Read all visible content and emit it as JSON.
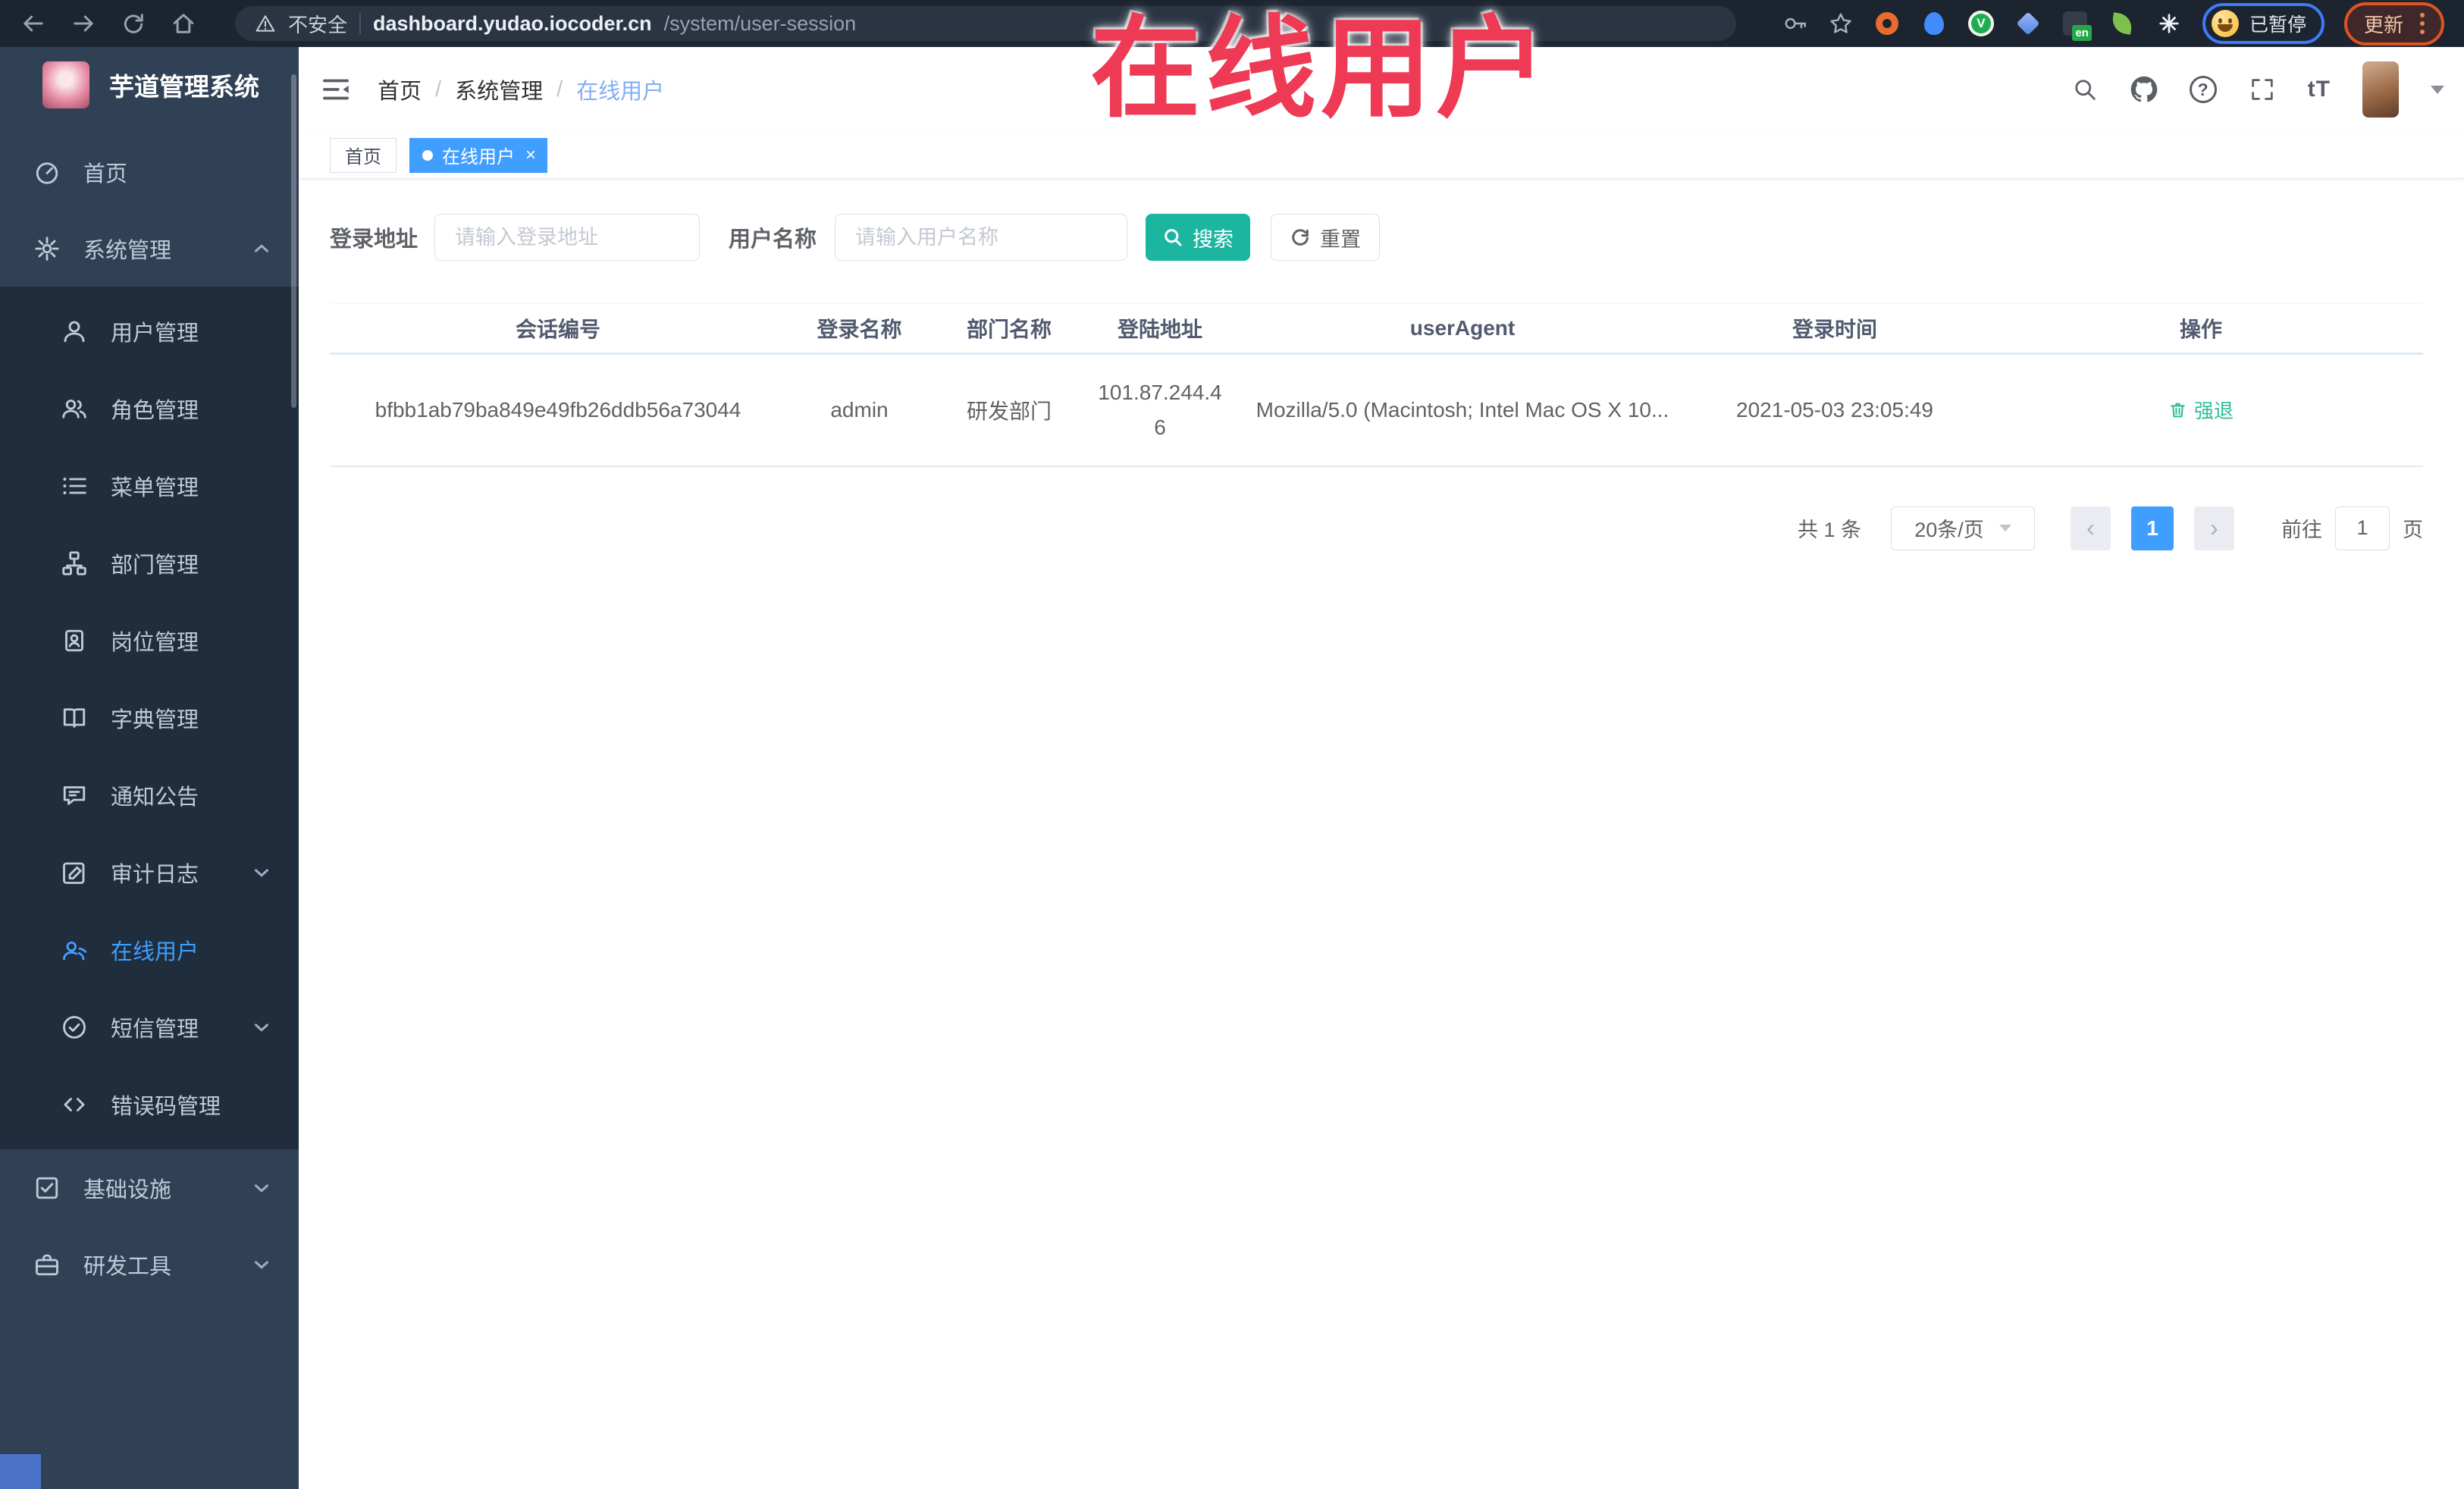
{
  "browser": {
    "security": "不安全",
    "url_host": "dashboard.yudao.iocoder.cn",
    "url_path": "/system/user-session",
    "ext_en": "en",
    "ext_green_letter": "V",
    "paused": "已暂停",
    "update": "更新"
  },
  "annotation": {
    "text": "在线用户",
    "color": "#ee3a55"
  },
  "sidebar": {
    "logo_title": "芋道管理系统",
    "home": "首页",
    "system_group": "系统管理",
    "system_items": [
      "用户管理",
      "角色管理",
      "菜单管理",
      "部门管理",
      "岗位管理",
      "字典管理",
      "通知公告",
      "审计日志",
      "在线用户",
      "短信管理",
      "错误码管理"
    ],
    "active_item": "在线用户",
    "infra_group": "基础设施",
    "devtools_group": "研发工具"
  },
  "header": {
    "breadcrumbs": [
      "首页",
      "系统管理",
      "在线用户"
    ],
    "font_size_label": "tT",
    "help_label": "?"
  },
  "tabs": [
    {
      "label": "首页",
      "active": false
    },
    {
      "label": "在线用户",
      "active": true,
      "close": "×"
    }
  ],
  "filters": {
    "login_address_label": "登录地址",
    "login_address_placeholder": "请输入登录地址",
    "username_label": "用户名称",
    "username_placeholder": "请输入用户名称",
    "search_label": "搜索",
    "reset_label": "重置"
  },
  "table": {
    "columns": [
      "会话编号",
      "登录名称",
      "部门名称",
      "登陆地址",
      "userAgent",
      "登录时间",
      "操作"
    ],
    "rows": [
      {
        "session_id": "bfbb1ab79ba849e49fb26ddb56a73044",
        "login_name": "admin",
        "dept": "研发部门",
        "ip": "101.87.244.46",
        "user_agent": "Mozilla/5.0 (Macintosh; Intel Mac OS X 10...",
        "login_time": "2021-05-03 23:05:49",
        "action": "强退"
      }
    ]
  },
  "pagination": {
    "total": "共 1 条",
    "page_size": "20条/页",
    "prev": "‹",
    "next": "›",
    "page": "1",
    "goto": "前往",
    "goto_value": "1",
    "unit": "页"
  },
  "colors": {
    "accent_blue": "#409eff",
    "teal_button": "#1cb5a0",
    "annotation_red": "#ee3a55",
    "sidebar_bg": "#304156",
    "submenu_bg": "#1f2d3d",
    "browser_bar_bg": "#1c2430"
  }
}
